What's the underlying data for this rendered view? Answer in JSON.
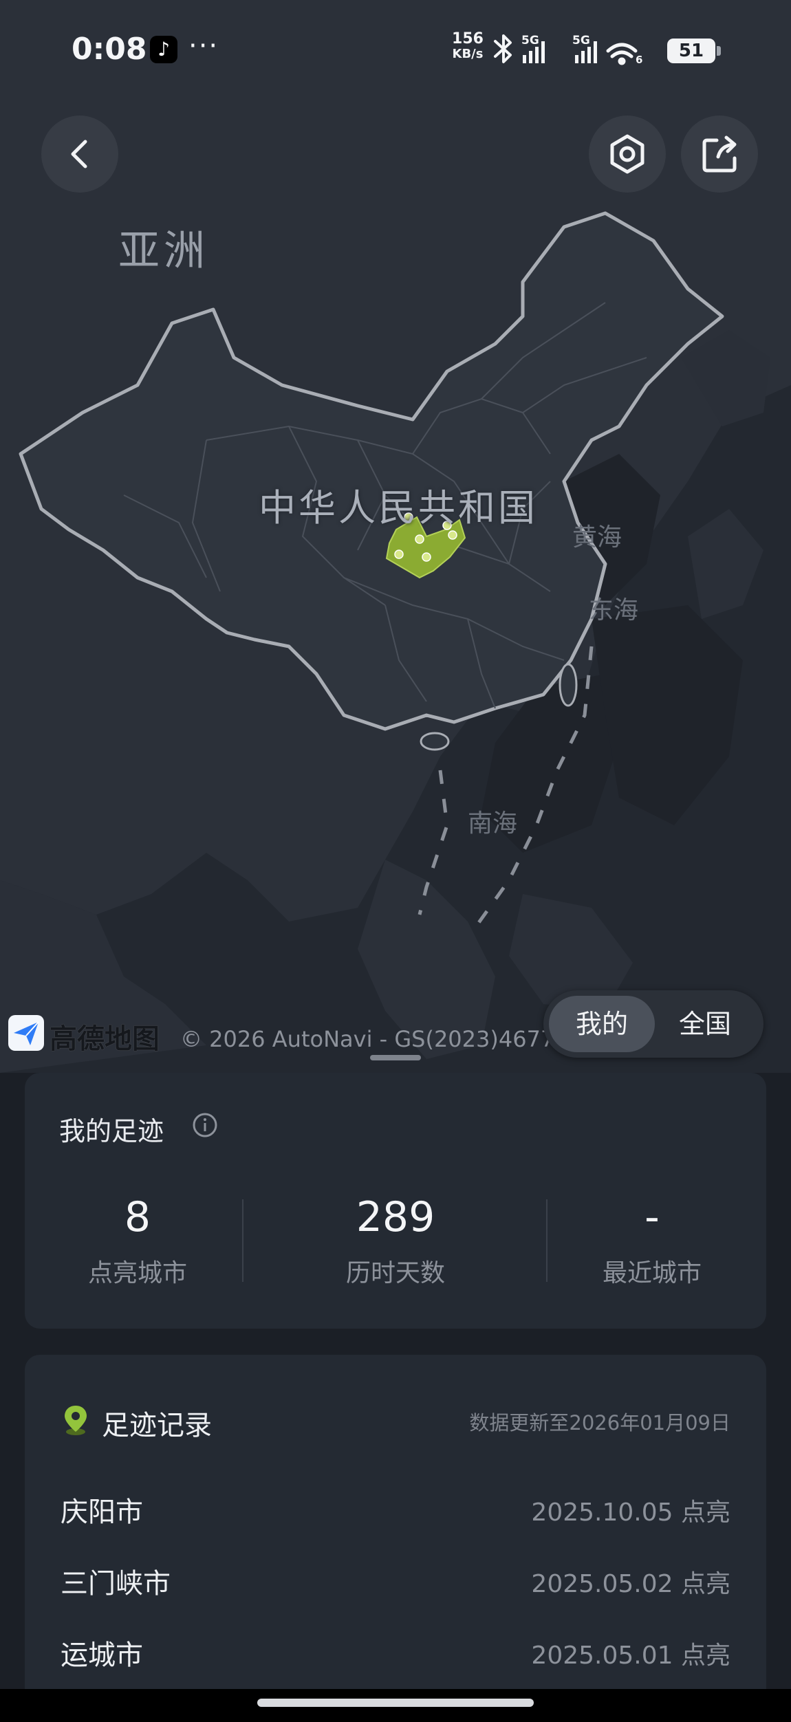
{
  "status_bar": {
    "time": "0:08",
    "tiktok_icon": "tiktok-icon",
    "more": "···",
    "speed_value": "156",
    "speed_unit": "KB/s",
    "network_1": "5G",
    "network_2": "5G",
    "wifi_badge": "6",
    "battery": "51"
  },
  "map": {
    "label_asia": "亚洲",
    "label_china": "中华人民共和国",
    "label_yellow_sea": "黄海",
    "label_east_sea": "东海",
    "label_south_sea": "南海",
    "provider_name": "高德地图",
    "copyright": "© 2026 AutoNavi - GS(2023)4677号",
    "highlight_color": "#9cbf3a"
  },
  "toggle": {
    "mine": "我的",
    "all": "全国",
    "selected": "我的"
  },
  "stats_card": {
    "title": "我的足迹",
    "stats": [
      {
        "value": "8",
        "label": "点亮城市"
      },
      {
        "value": "289",
        "label": "历时天数"
      },
      {
        "value": "-",
        "label": "最近城市"
      }
    ]
  },
  "records_card": {
    "title": "足迹记录",
    "updated": "数据更新至2026年01月09日",
    "rows": [
      {
        "city": "庆阳市",
        "date": "2025.10.05 点亮"
      },
      {
        "city": "三门峡市",
        "date": "2025.05.02 点亮"
      },
      {
        "city": "运城市",
        "date": "2025.05.01 点亮"
      }
    ]
  }
}
